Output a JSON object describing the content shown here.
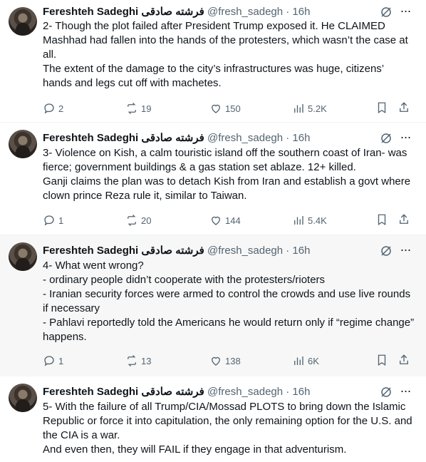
{
  "tweets": [
    {
      "name": "Fereshteh Sadeghi فرشته صادقی",
      "meta": "@fresh_sadegh · 16h",
      "text": "2- Though the plot failed after President Trump exposed it. He CLAIMED Mashhad had fallen into the hands of the protesters, which wasn’t the case at all.\nThe extent of the damage to the city’s infrastructures was huge, citizens’ hands and legs cut off with machetes.",
      "replies": "2",
      "reposts": "19",
      "likes": "150",
      "views": "5.2K"
    },
    {
      "name": "Fereshteh Sadeghi فرشته صادقی",
      "meta": "@fresh_sadegh · 16h",
      "text": "3- Violence on Kish, a calm touristic island off the southern coast of Iran- was fierce; government buildings & a gas station set ablaze. 12+ killed.\nGanji claims the plan was to detach Kish from Iran and establish a govt where clown prince Reza rule it, similar to Taiwan.",
      "replies": "1",
      "reposts": "20",
      "likes": "144",
      "views": "5.4K"
    },
    {
      "name": "Fereshteh Sadeghi فرشته صادقی",
      "meta": "@fresh_sadegh · 16h",
      "text": "4- What went wrong?\n- ordinary people didn’t cooperate with the protesters/rioters\n- Iranian security forces were armed to control the crowds and use live rounds if necessary\n- Pahlavi reportedly told the Americans he would return only if “regime change” happens.",
      "replies": "1",
      "reposts": "13",
      "likes": "138",
      "views": "6K"
    },
    {
      "name": "Fereshteh Sadeghi فرشته صادقی",
      "meta": "@fresh_sadegh · 16h",
      "text": "5- With the failure of all Trump/CIA/Mossad PLOTS to bring down the Islamic Republic or force it into capitulation, the only remaining option for the U.S. and the CIA is a war.\nAnd even then, they will FAIL if they engage in that adventurism."
    }
  ],
  "more_glyph": "···",
  "colors": {
    "text": "#0f1419",
    "secondary": "#536471",
    "highlight_bg": "#f7f7f7"
  }
}
